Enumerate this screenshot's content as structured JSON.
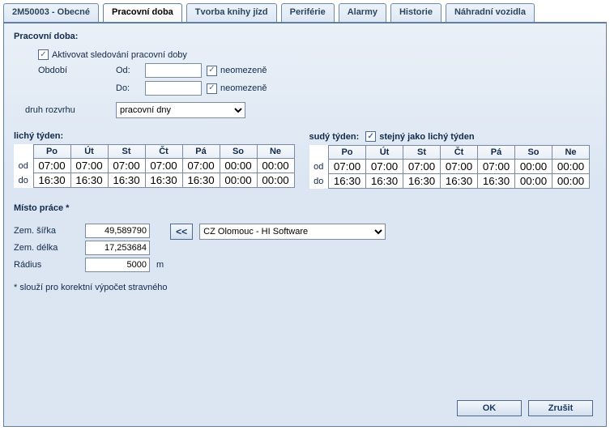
{
  "tabs": [
    {
      "label": "2M50003 - Obecné",
      "active": false
    },
    {
      "label": "Pracovní doba",
      "active": true
    },
    {
      "label": "Tvorba knihy jízd",
      "active": false
    },
    {
      "label": "Periférie",
      "active": false
    },
    {
      "label": "Alarmy",
      "active": false
    },
    {
      "label": "Historie",
      "active": false
    },
    {
      "label": "Náhradní vozidla",
      "active": false
    }
  ],
  "working_hours": {
    "heading": "Pracovní doba:",
    "activate_label": "Aktivovat sledování pracovní doby",
    "activate_checked": true,
    "obdobi_label": "Období",
    "od_label": "Od:",
    "od_value": "",
    "od_unlimited_label": "neomezeně",
    "od_unlimited_checked": true,
    "do_label": "Do:",
    "do_value": "",
    "do_unlimited_label": "neomezeně",
    "do_unlimited_checked": true,
    "schedule_type_label": "druh rozvrhu",
    "schedule_type_value": "pracovní dny"
  },
  "odd_week": {
    "title": "lichý týden:",
    "days": [
      "Po",
      "Út",
      "St",
      "Čt",
      "Pá",
      "So",
      "Ne"
    ],
    "od_label": "od",
    "do_label": "do",
    "od": [
      "07:00",
      "07:00",
      "07:00",
      "07:00",
      "07:00",
      "00:00",
      "00:00"
    ],
    "do": [
      "16:30",
      "16:30",
      "16:30",
      "16:30",
      "16:30",
      "00:00",
      "00:00"
    ]
  },
  "even_week": {
    "title": "sudý týden:",
    "same_as_label": "stejný jako lichý týden",
    "same_as_checked": true,
    "days": [
      "Po",
      "Út",
      "St",
      "Čt",
      "Pá",
      "So",
      "Ne"
    ],
    "od_label": "od",
    "do_label": "do",
    "od": [
      "07:00",
      "07:00",
      "07:00",
      "07:00",
      "07:00",
      "00:00",
      "00:00"
    ],
    "do": [
      "16:30",
      "16:30",
      "16:30",
      "16:30",
      "16:30",
      "00:00",
      "00:00"
    ]
  },
  "workplace": {
    "heading": "Místo práce *",
    "lat_label": "Zem. šířka",
    "lat_value": "49,589790",
    "lon_label": "Zem. délka",
    "lon_value": "17,253684",
    "radius_label": "Rádius",
    "radius_value": "5000",
    "radius_unit": "m",
    "arrow_label": "<<",
    "place_value": "CZ Olomouc - HI Software",
    "footnote": "* slouží pro korektní výpočet stravného"
  },
  "buttons": {
    "ok": "OK",
    "cancel": "Zrušit"
  }
}
